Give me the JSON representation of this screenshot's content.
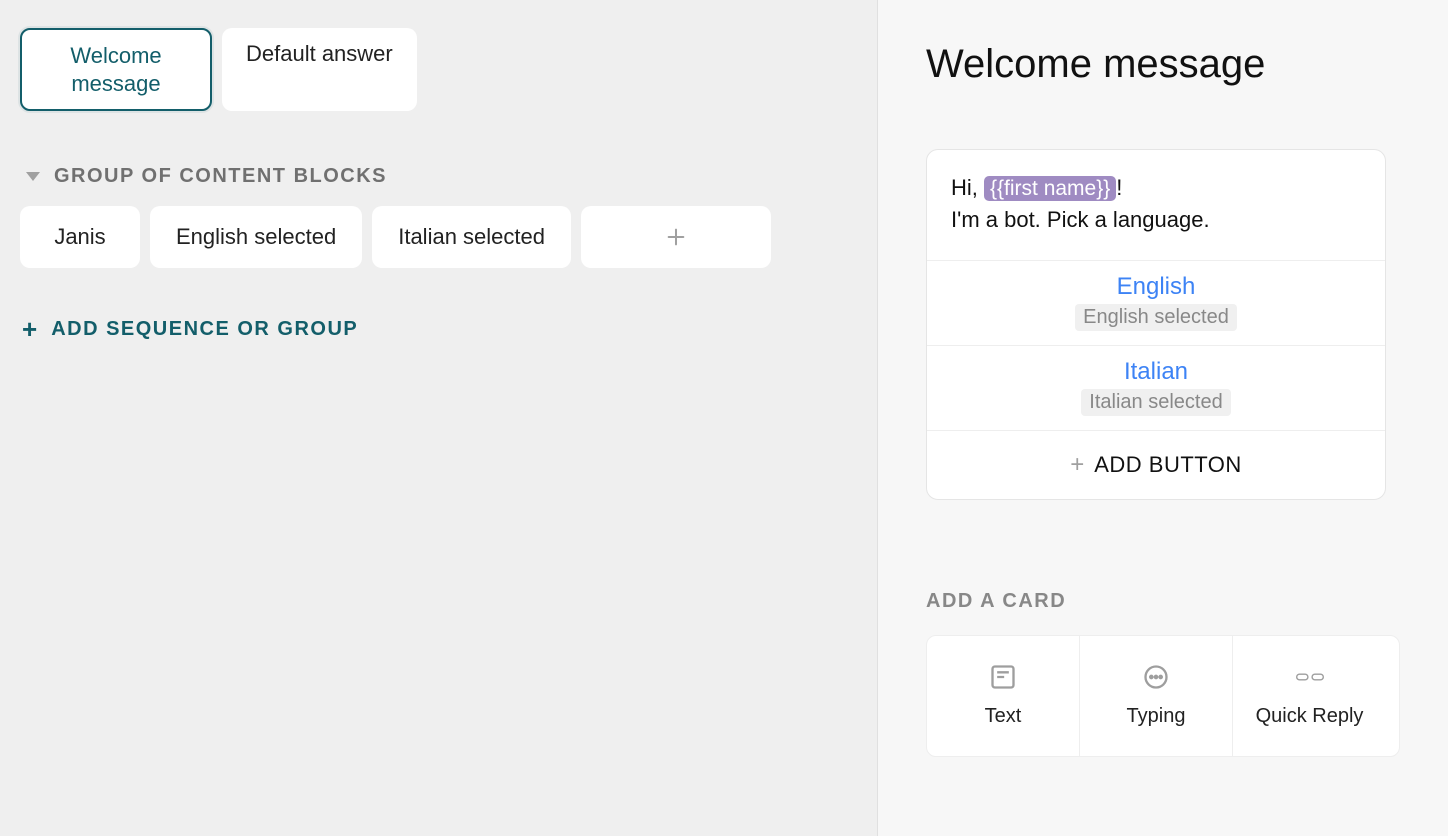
{
  "left": {
    "chips": [
      {
        "label": "Welcome message",
        "active": true
      },
      {
        "label": "Default answer",
        "active": false
      }
    ],
    "group_title": "GROUP OF CONTENT BLOCKS",
    "blocks": [
      {
        "label": "Janis"
      },
      {
        "label": "English selected"
      },
      {
        "label": "Italian selected"
      }
    ],
    "add_sequence_label": "ADD SEQUENCE OR GROUP"
  },
  "right": {
    "title": "Welcome message",
    "message": {
      "pre": "Hi, ",
      "var": "{{first name}}",
      "post": "!",
      "line2": "I'm a bot. Pick a language."
    },
    "options": [
      {
        "label": "English",
        "sub": "English selected"
      },
      {
        "label": "Italian",
        "sub": "Italian selected"
      }
    ],
    "add_button_label": "ADD BUTTON",
    "add_card_label": "ADD A CARD",
    "card_types": [
      {
        "icon": "text-icon",
        "label": "Text"
      },
      {
        "icon": "typing-icon",
        "label": "Typing"
      },
      {
        "icon": "quick-reply-icon",
        "label": "Quick Reply"
      }
    ]
  }
}
